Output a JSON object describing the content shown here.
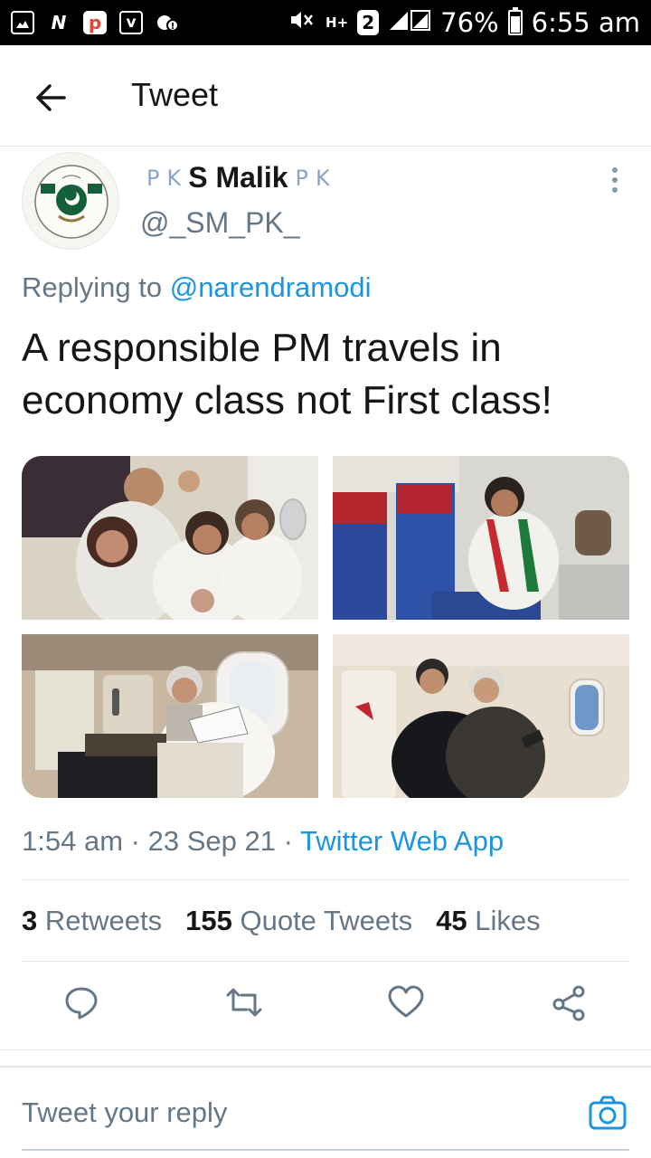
{
  "status_bar": {
    "network_2": "2",
    "network_hplus": "H+",
    "battery_percent": "76%",
    "time": "6:55 am"
  },
  "header": {
    "title": "Tweet"
  },
  "tweet": {
    "display_name": "S Malik",
    "name_decor_left": [
      "P",
      "K"
    ],
    "name_decor_right": [
      "P",
      "K"
    ],
    "handle": "@_SM_PK_",
    "replying_prefix": "Replying to",
    "replying_to": "@narendramodi",
    "text": "A responsible PM travels in economy class not First class!",
    "time": "1:54 am",
    "date": "23 Sep 21",
    "source": "Twitter Web App",
    "separator": "·"
  },
  "stats": {
    "retweets_count": "3",
    "retweets_label": "Retweets",
    "quotes_count": "155",
    "quotes_label": "Quote Tweets",
    "likes_count": "45",
    "likes_label": "Likes"
  },
  "reply": {
    "placeholder": "Tweet your reply"
  },
  "colors": {
    "link": "#1b95e0",
    "secondary_text": "#657786",
    "divider": "#e1e8ed"
  }
}
